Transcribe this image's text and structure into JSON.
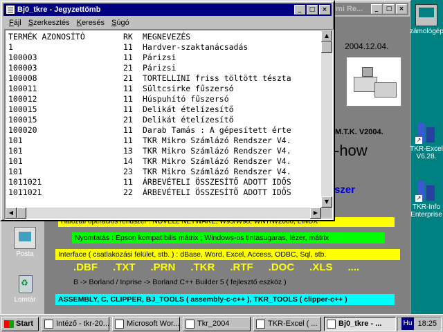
{
  "background_window": {
    "title": "lmi Re..."
  },
  "bg_content": {
    "date": "2004.12.04.",
    "mtk": "M.T.K. V2004.",
    "howto": "-how",
    "szer": "szer",
    "network_line": "Hálózati operációs rendszer : NOVELL NETWARE, W95/W98, WNT/W2000, LINUX",
    "nyomtatas": "Nyomtatás : Epson kompatíbilis mátrix ;  Windows-os tintasugaras, lézer, mátrix",
    "interface": "Interface ( csatlakozási felület, stb. )  : dBase, Word, Excel, Access, ODBC, Sql, stb.",
    "extensions": [
      ".DBF",
      ".TXT",
      ".PRN",
      ".TKR",
      ".RTF",
      ".DOC",
      ".XLS",
      "...."
    ],
    "borland": "B -> Borland / Inprise -> Borland C++ Builder 5     ( fejlesztő eszköz )",
    "assembly": "ASSEMBLY, C, CLIPPER, BJ_TOOLS ( assembly-c-c++ ), TKR_TOOLS ( clipper-c++ )"
  },
  "desktop_left": {
    "posta": "Posta",
    "lomtar": "Lomtár"
  },
  "desktop_right": {
    "computer": "zámológép",
    "tkr_excel_1": "TKR-Excel",
    "tkr_excel_2": "V6.28.",
    "tkr_info_1": "TKR-Info",
    "tkr_info_2": "Enterprise"
  },
  "notepad": {
    "title": "Bj0_tkre - Jegyzettömb",
    "menu": [
      "Fájl",
      "Szerkesztés",
      "Keresés",
      "Súgó"
    ],
    "lines": [
      [
        "TERMÉK AZONOSÍTÓ",
        "RK",
        "MEGNEVEZÉS"
      ],
      [
        "1",
        "11",
        "Hardver-szaktanácsadás"
      ],
      [
        "100003",
        "11",
        "Párizsi"
      ],
      [
        "100003",
        "21",
        "Párizsi"
      ],
      [
        "100008",
        "21",
        "TORTELLINI friss töltött tészta"
      ],
      [
        "100011",
        "11",
        "Sültcsirke fűszersó"
      ],
      [
        "100012",
        "11",
        "Húspuhító fűszersó"
      ],
      [
        "100015",
        "11",
        "Delikát ételízesítő"
      ],
      [
        "100015",
        "21",
        "Delikát ételízesítő"
      ],
      [
        "100020",
        "11",
        "Darab Tamás : A gépesített érte"
      ],
      [
        "101",
        "11",
        "TKR Mikro Számlázó Rendszer V4."
      ],
      [
        "101",
        "13",
        "TKR Mikro Számlázó Rendszer V4."
      ],
      [
        "101",
        "14",
        "TKR Mikro Számlázó Rendszer V4."
      ],
      [
        "101",
        "23",
        "TKR Mikro Számlázó Rendszer V4."
      ],
      [
        "1011021",
        "11",
        "ÁRBEVÉTELI ÖSSZESÍTŐ ADOTT IDŐS"
      ],
      [
        "1011021",
        "22",
        "ÁRBEVÉTELI ÖSSZESÍTŐ ADOTT IDŐS"
      ]
    ]
  },
  "taskbar": {
    "start": "Start",
    "tasks": [
      "Intéző - tkr-20...",
      "Microsoft Wor...",
      "Tkr_2004",
      "TKR-Excel ( ...",
      "Bj0_tkre - ..."
    ],
    "lang": "Hu",
    "clock": "18:25"
  }
}
